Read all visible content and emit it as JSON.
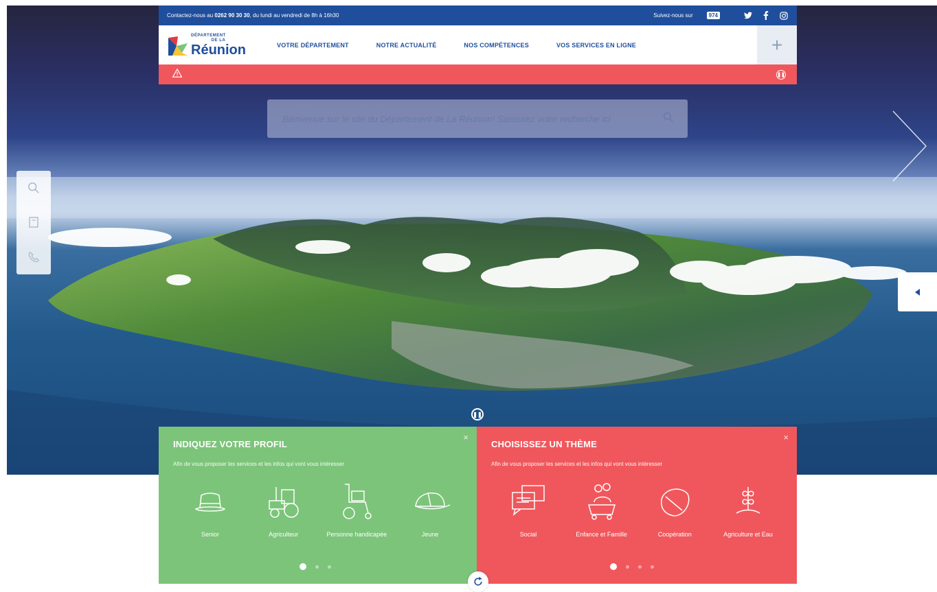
{
  "topbar": {
    "contact_prefix": "Contactez-nous au ",
    "contact_phone": "0262 90 30 30",
    "contact_suffix": ", du lundi au vendredi de 8h à 16h30",
    "follow_label": "Suivez-nous sur",
    "badge": "974",
    "social": [
      "twitter",
      "facebook",
      "instagram"
    ]
  },
  "logo": {
    "line1": "DÉPARTEMENT",
    "line2": "DE LA",
    "name": "Réunion"
  },
  "nav": [
    {
      "label": "VOTRE DÉPARTEMENT"
    },
    {
      "label": "NOTRE ACTUALITÉ"
    },
    {
      "label": "NOS COMPÉTENCES"
    },
    {
      "label": "VOS SERVICES EN LIGNE"
    }
  ],
  "header": {
    "plus_label": "+"
  },
  "alert": {
    "icon": "warning-icon",
    "pause_icon": "pause-icon"
  },
  "search": {
    "placeholder": "Bienvenue sur le site du Département de La Réunion! Saisissez votre recherche ici",
    "icon": "search-icon"
  },
  "sidetools": [
    "search-icon",
    "document-icon",
    "phone-icon"
  ],
  "profile_card": {
    "title": "INDIQUEZ VOTRE PROFIL",
    "subtitle": "Afin de vous proposer les services et les infos qui vont vous intéresser",
    "items": [
      {
        "label": "Senior",
        "icon": "hat-icon"
      },
      {
        "label": "Agriculteur",
        "icon": "tractor-icon"
      },
      {
        "label": "Personne handicapée",
        "icon": "wheelchair-icon"
      },
      {
        "label": "Jeune",
        "icon": "cap-icon"
      }
    ],
    "close": "×",
    "pages": 3,
    "current_page": 1
  },
  "theme_card": {
    "title": "CHOISISSEZ UN THÈME",
    "subtitle": "Afin de vous proposer les services et les infos qui vont vous intéresser",
    "items": [
      {
        "label": "Social",
        "icon": "chat-icon"
      },
      {
        "label": "Enfance et Famille",
        "icon": "family-icon"
      },
      {
        "label": "Coopération",
        "icon": "leaf-icon"
      },
      {
        "label": "Agriculture et Eau",
        "icon": "plant-icon"
      }
    ],
    "close": "×",
    "pages": 4,
    "current_page": 1
  },
  "colors": {
    "brand_blue": "#1f4e9c",
    "alert_red": "#f0575c",
    "profile_green": "#7cc47a",
    "theme_red": "#f0575c"
  }
}
